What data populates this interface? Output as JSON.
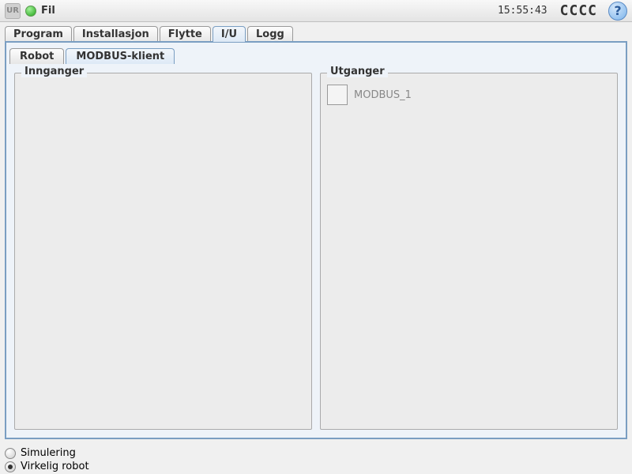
{
  "titlebar": {
    "menu_file": "Fil",
    "clock": "15:55:43",
    "brand": "CCCC",
    "help": "?"
  },
  "main_tabs": [
    {
      "label": "Program",
      "active": false
    },
    {
      "label": "Installasjon",
      "active": false
    },
    {
      "label": "Flytte",
      "active": false
    },
    {
      "label": "I/U",
      "active": true
    },
    {
      "label": "Logg",
      "active": false
    }
  ],
  "sub_tabs": [
    {
      "label": "Robot",
      "active": false
    },
    {
      "label": "MODBUS-klient",
      "active": true
    }
  ],
  "io": {
    "inputs_legend": "Innganger",
    "outputs_legend": "Utganger",
    "outputs": [
      {
        "label": "MODBUS_1",
        "checked": false
      }
    ]
  },
  "footer": {
    "simulation": "Simulering",
    "real_robot": "Virkelig robot",
    "selected": "real_robot"
  }
}
